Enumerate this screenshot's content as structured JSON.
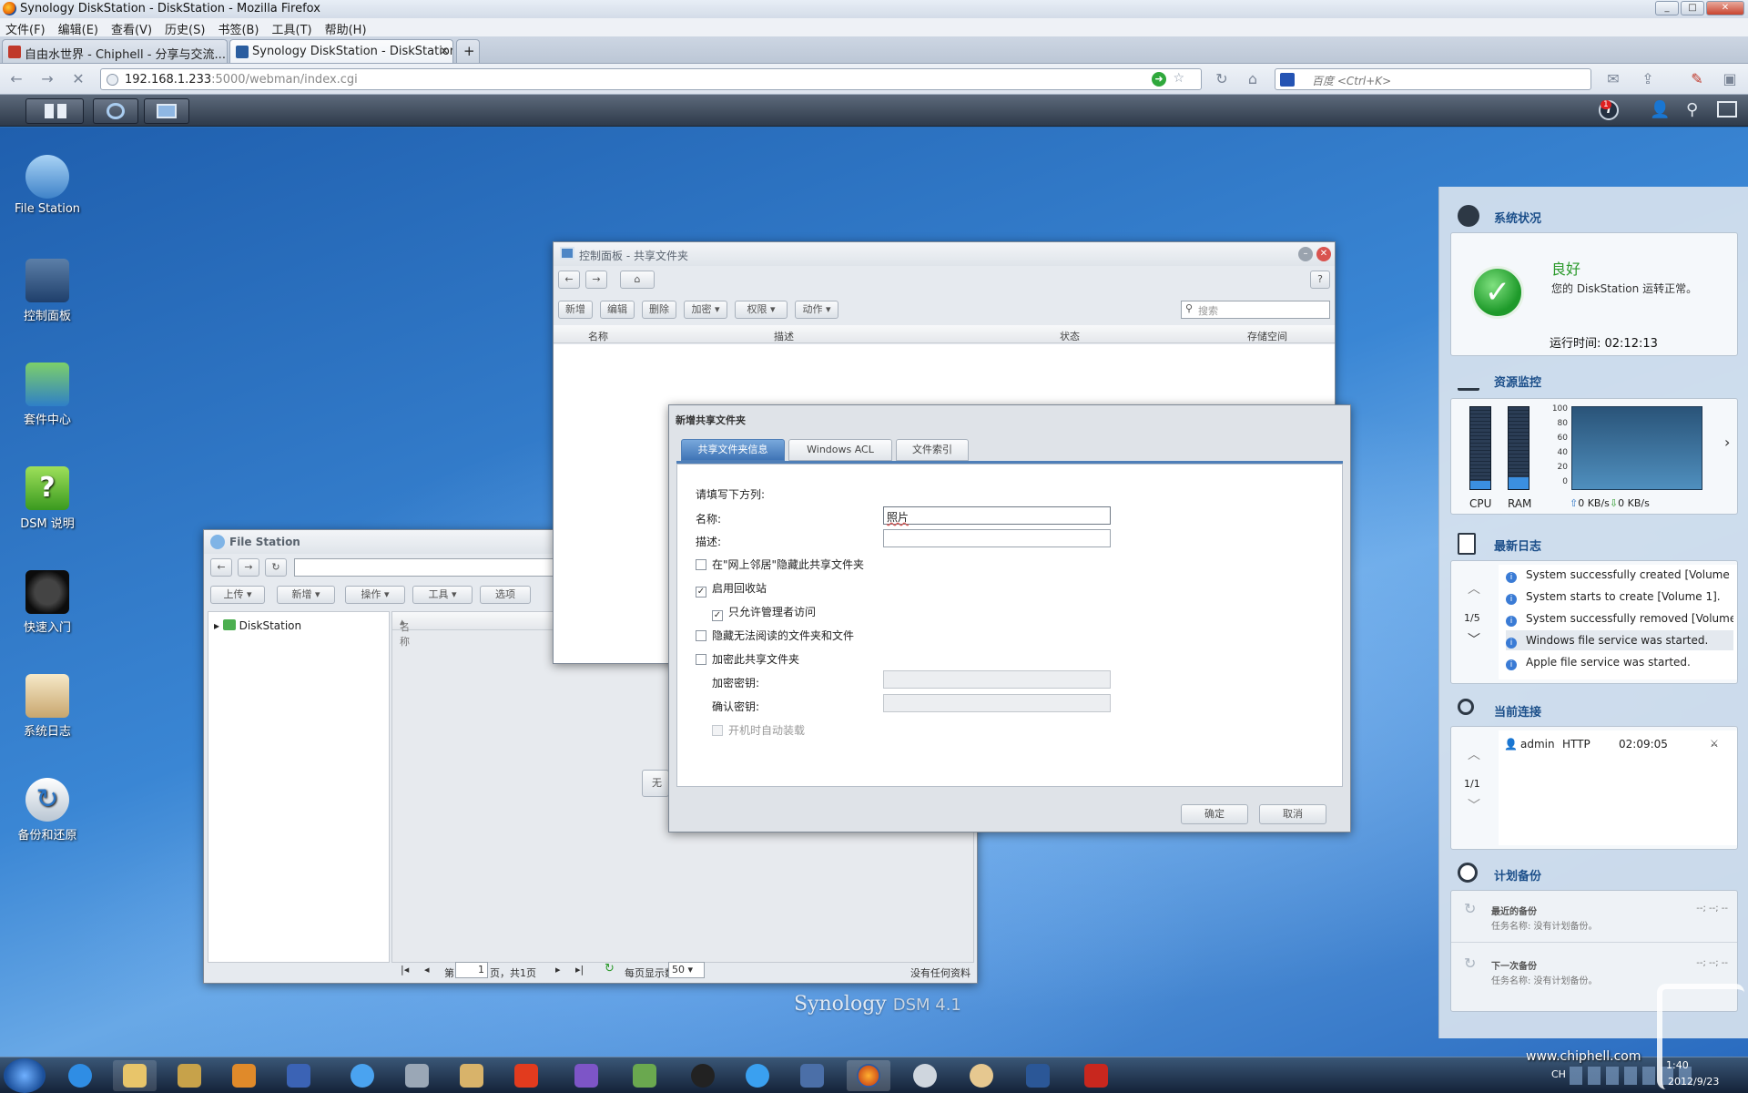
{
  "browser": {
    "window_title": "Synology DiskStation - DiskStation - Mozilla Firefox",
    "menu": [
      "文件(F)",
      "编辑(E)",
      "查看(V)",
      "历史(S)",
      "书签(B)",
      "工具(T)",
      "帮助(H)"
    ],
    "tabs": [
      {
        "label": "自由水世界 - Chiphell - 分享与交流..."
      },
      {
        "label": "Synology DiskStation - DiskStation"
      }
    ],
    "url_host": "192.168.1.233",
    "url_rest": ":5000/webman/index.cgi",
    "search_placeholder": "百度 <Ctrl+K>"
  },
  "dsm": {
    "notification_count": "1",
    "desktop_icons": [
      "File Station",
      "控制面板",
      "套件中心",
      "DSM 说明",
      "快速入门",
      "系统日志",
      "备份和还原"
    ],
    "brand": "Synology",
    "version": "DSM 4.1"
  },
  "control_panel": {
    "title": "控制面板 - 共享文件夹",
    "toolbar": [
      "新增",
      "编辑",
      "删除",
      "加密",
      "权限",
      "动作"
    ],
    "search_placeholder": "搜索",
    "columns": [
      "名称",
      "描述",
      "状态",
      "存储空间"
    ],
    "hidden_button_fragment": "无"
  },
  "file_station": {
    "title": "File Station",
    "toolbar": [
      "上传",
      "新增",
      "操作",
      "工具",
      "选项"
    ],
    "tree_root": "DiskStation",
    "column_name": "名称",
    "pager": {
      "page_label_pre": "第",
      "page": "1",
      "page_label_post": "页，共1页",
      "per_page_label": "每页显示数",
      "per_page": "50",
      "status": "没有任何资料"
    }
  },
  "dialog": {
    "title": "新增共享文件夹",
    "tabs": [
      "共享文件夹信息",
      "Windows ACL",
      "文件索引"
    ],
    "prompt": "请填写下方列:",
    "name_label": "名称:",
    "name_value": "照片",
    "desc_label": "描述:",
    "desc_value": "",
    "options": [
      {
        "label": "在\"网上邻居\"隐藏此共享文件夹",
        "checked": false
      },
      {
        "label": "启用回收站",
        "checked": true
      },
      {
        "label": "只允许管理者访问",
        "checked": true
      },
      {
        "label": "隐藏无法阅读的文件夹和文件",
        "checked": false
      },
      {
        "label": "加密此共享文件夹",
        "checked": false
      }
    ],
    "key_label": "加密密钥:",
    "confirm_label": "确认密钥:",
    "automount_label": "开机时自动装载",
    "ok": "确定",
    "cancel": "取消"
  },
  "widgets": {
    "health": {
      "title": "系统状况",
      "status": "良好",
      "message": "您的 DiskStation 运转正常。",
      "uptime": "运行时间: 02:12:13"
    },
    "resource": {
      "title": "资源监控",
      "cpu_label": "CPU",
      "ram_label": "RAM",
      "cpu_level": 0.1,
      "ram_level": 0.15,
      "y_ticks": [
        "100",
        "80",
        "60",
        "40",
        "20",
        "0"
      ],
      "upload": "0 KB/s",
      "download": "0 KB/s"
    },
    "logs": {
      "title": "最新日志",
      "page": "1/5",
      "items": [
        "System successfully created [Volume 1].",
        "System starts to create [Volume 1].",
        "System successfully removed [Volume 1].",
        "Windows file service was started.",
        "Apple file service was started."
      ]
    },
    "connections": {
      "title": "当前连接",
      "page": "1/1",
      "user": "admin",
      "protocol": "HTTP",
      "time": "02:09:05"
    },
    "backup": {
      "title": "计划备份",
      "recent_label": "最近的备份",
      "recent_task": "任务名称: 没有计划备份。",
      "recent_time": "--; --; --",
      "next_label": "下一次备份",
      "next_task": "任务名称: 没有计划备份。",
      "next_time": "--; --; --"
    }
  },
  "taskbar": {
    "ime": "CH",
    "time": "1:40",
    "date": "2012/9/23",
    "watermark": "www.chiphell.com"
  }
}
